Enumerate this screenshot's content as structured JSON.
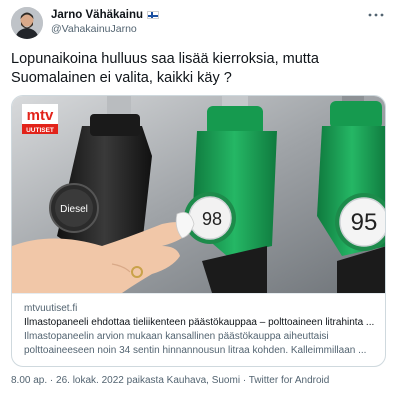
{
  "user": {
    "display_name": "Jarno Vähäkainu",
    "handle": "@VahakainuJarno"
  },
  "tweet": {
    "text": "Lopunaikoina hulluus saa lisää kierroksia, mutta Suomalainen ei valita, kaikki käy ?"
  },
  "card": {
    "logo_text": "mtv",
    "logo_sub": "UUTISET",
    "pump_labels": [
      "Diesel",
      "98",
      "95"
    ],
    "domain": "mtvuutiset.fi",
    "title": "Ilmastopaneeli ehdottaa tieliikenteen päästökauppaa – polttoaineen litrahinta ...",
    "description": "Ilmastopaneelin arvion mukaan kansallinen päästökauppa aiheuttaisi polttoaineeseen noin 34 sentin hinnannousun litraa kohden. Kalleimmillaan ..."
  },
  "meta": {
    "text": "8.00 ap. · 26. lokak. 2022 paikasta Kauhava, Suomi · Twitter for Android"
  },
  "colors": {
    "logo_red": "#e2231a",
    "pump_green": "#1f9e56",
    "text_primary": "#0f1419",
    "text_secondary": "#536471"
  }
}
